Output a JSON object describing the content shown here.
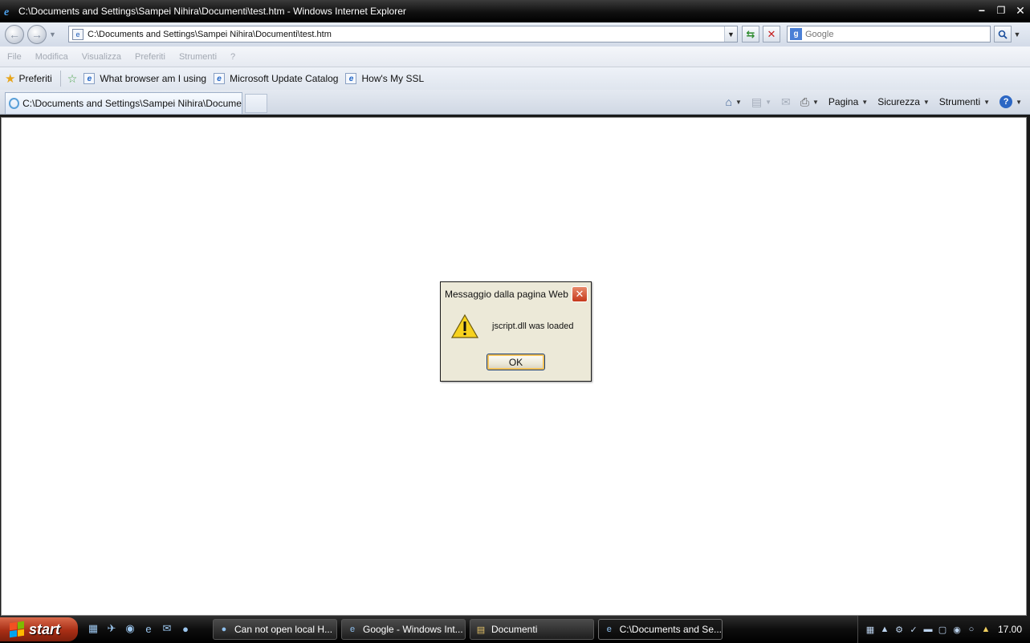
{
  "window": {
    "title": "C:\\Documents and Settings\\Sampei Nihira\\Documenti\\test.htm - Windows Internet Explorer",
    "minimize": "−",
    "restore": "❐",
    "close": "✕"
  },
  "address": {
    "url": "C:\\Documents and Settings\\Sampei Nihira\\Documenti\\test.htm"
  },
  "search": {
    "placeholder": "Google"
  },
  "menu": [
    "File",
    "Modifica",
    "Visualizza",
    "Preferiti",
    "Strumenti",
    "?"
  ],
  "favorites": {
    "label": "Preferiti",
    "items": [
      "What browser am I using",
      "Microsoft Update Catalog",
      "How's My SSL"
    ]
  },
  "tab": {
    "label": "C:\\Documents and Settings\\Sampei Nihira\\Documenti\\..."
  },
  "commands": {
    "page": "Pagina",
    "security": "Sicurezza",
    "tools": "Strumenti",
    "help": "?"
  },
  "dialog": {
    "title": "Messaggio dalla pagina Web",
    "message": "jscript.dll was loaded",
    "ok": "OK",
    "close": "✕"
  },
  "taskbar": {
    "start": "start",
    "tasks": [
      "Can not open local H...",
      "Google - Windows Int...",
      "Documenti",
      "C:\\Documents and Se..."
    ],
    "clock": "17.00"
  },
  "icons": {
    "back": "back-arrow-icon",
    "forward": "forward-arrow-icon",
    "refresh": "refresh-icon",
    "stop": "stop-icon",
    "search": "search-icon",
    "warning": "warning-icon",
    "home": "home-icon",
    "feeds": "feeds-icon",
    "mail": "mail-icon",
    "print": "print-icon"
  }
}
